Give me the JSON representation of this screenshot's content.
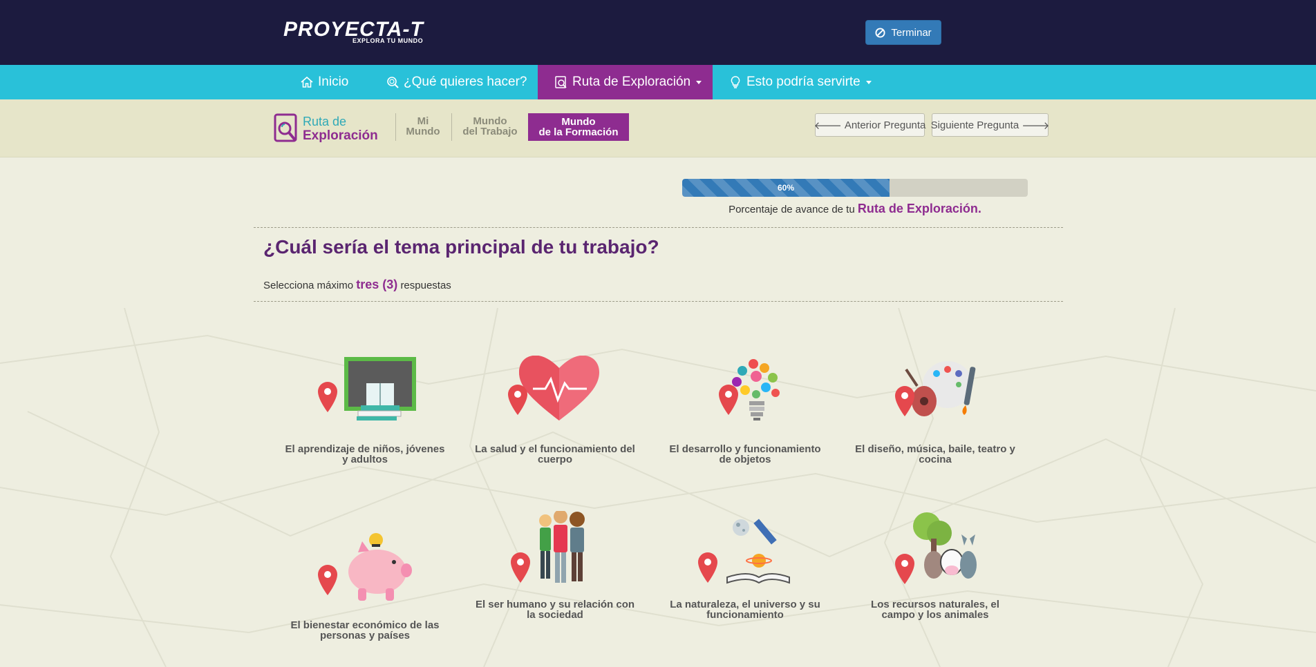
{
  "header": {
    "logo_text": "PROYECTA-T",
    "logo_tagline": "EXPLORA TU MUNDO",
    "terminar_label": "Terminar"
  },
  "nav": {
    "items": [
      {
        "label": "Inicio",
        "icon": "home-icon"
      },
      {
        "label": "¿Qué quieres hacer?",
        "icon": "search-icon"
      },
      {
        "label": "Ruta de Exploración",
        "icon": "exploration-icon",
        "active": true
      },
      {
        "label": "Esto podría servirte",
        "icon": "lightbulb-icon"
      }
    ]
  },
  "subheader": {
    "ruta_line1": "Ruta de",
    "ruta_line2": "Exploración",
    "tabs": [
      {
        "line1": "Mi",
        "line2": "Mundo"
      },
      {
        "line1": "Mundo",
        "line2": "del Trabajo"
      },
      {
        "line1": "Mundo",
        "line2": "de la Formación",
        "active": true
      }
    ],
    "prev_label": "Anterior Pregunta",
    "next_label": "Siguiente Pregunta"
  },
  "progress": {
    "value": 0.6,
    "label": "60%",
    "caption_prefix": "Porcentaje de avance de tu",
    "caption_emph": "Ruta de Exploración."
  },
  "question": {
    "title": "¿Cuál sería el tema principal de tu trabajo?",
    "instr_prefix": "Selecciona máximo",
    "instr_emph": "tres (3)",
    "instr_suffix": "respuestas"
  },
  "options": [
    {
      "label": "El aprendizaje de niños, jóvenes y adultos",
      "icon": "education-icon"
    },
    {
      "label": "La salud y el funcionamiento del cuerpo",
      "icon": "heart-icon"
    },
    {
      "label": "El desarrollo y funcionamiento de objetos",
      "icon": "lightbulb-gears-icon"
    },
    {
      "label": "El diseño, música, baile, teatro y cocina",
      "icon": "arts-icon"
    },
    {
      "label": "El bienestar económico de las personas y países",
      "icon": "piggy-bank-icon"
    },
    {
      "label": "El ser humano y su relación con la sociedad",
      "icon": "people-icon"
    },
    {
      "label": "La naturaleza, el universo y su funcionamiento",
      "icon": "universe-icon"
    },
    {
      "label": "Los recursos naturales, el campo y los animales",
      "icon": "farm-animals-icon"
    }
  ],
  "colors": {
    "header_bg": "#1c1b3f",
    "nav_bg": "#29c1d9",
    "accent_purple": "#8e2c90",
    "button_blue": "#337ab7",
    "page_bg": "#eeeee0"
  }
}
